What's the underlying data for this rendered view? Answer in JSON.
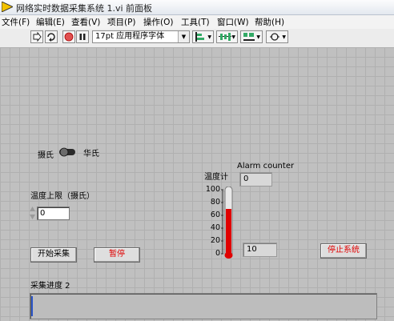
{
  "window": {
    "title": "网络实时数据采集系统 1.vi 前面板"
  },
  "menu": [
    {
      "label": "文件(F)"
    },
    {
      "label": "编辑(E)"
    },
    {
      "label": "查看(V)"
    },
    {
      "label": "项目(P)"
    },
    {
      "label": "操作(O)"
    },
    {
      "label": "工具(T)"
    },
    {
      "label": "窗口(W)"
    },
    {
      "label": "帮助(H)"
    }
  ],
  "toolbar": {
    "font_select": "17pt 应用程序字体",
    "icons": [
      "run-arrow-icon",
      "run-continuously-icon",
      "abort-icon",
      "pause-icon",
      "align-icon",
      "distribute-icon",
      "resize-icon",
      "reorder-icon"
    ]
  },
  "panel": {
    "switch": {
      "left_label": "摄氏",
      "right_label": "华氏"
    },
    "upper_limit": {
      "label": "温度上限（摄氏）",
      "value": "0"
    },
    "thermometer": {
      "label": "温度计",
      "ticks": [
        "100",
        "80",
        "60",
        "40",
        "20",
        "0"
      ],
      "fill_fraction": 0.7,
      "fill_color": "#e00000"
    },
    "alarm": {
      "label": "Alarm counter",
      "value": "0"
    },
    "temp_value": "10",
    "buttons": {
      "start": "开始采集",
      "pause": "暂停",
      "stop": "停止系统"
    },
    "progress": {
      "label": "采集进度 2",
      "value_fraction": 0.0
    }
  }
}
